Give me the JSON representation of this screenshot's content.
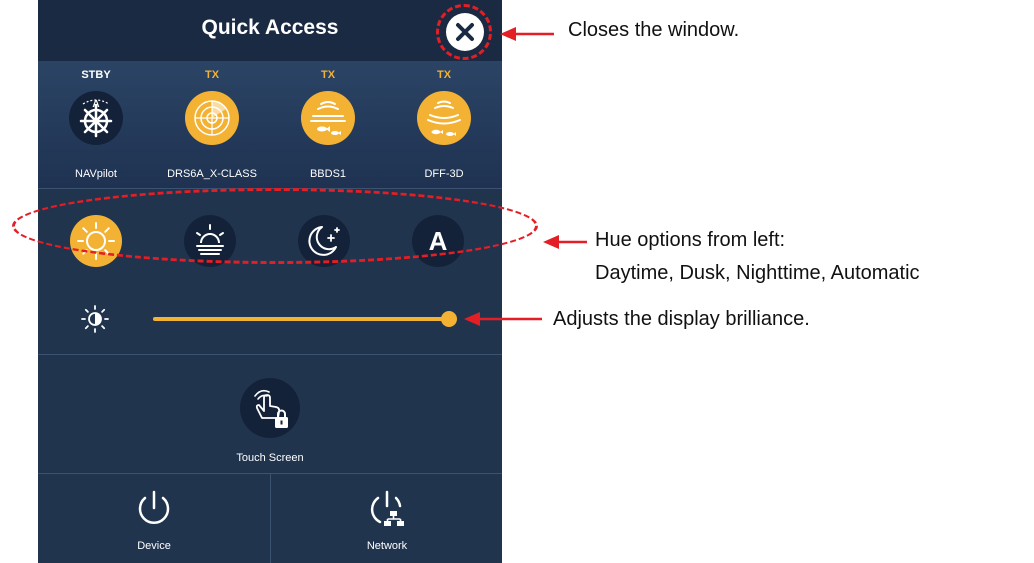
{
  "panel": {
    "title": "Quick Access",
    "close_icon": "close-icon"
  },
  "devices": [
    {
      "status": "STBY",
      "label": "NAVpilot",
      "icon": "autopilot-helm-icon",
      "status_color": "#ffffff",
      "icon_bg": "#132238"
    },
    {
      "status": "TX",
      "label": "DRS6A_X-CLASS",
      "icon": "radar-icon",
      "status_color": "#f3b234",
      "icon_bg": "#f3b234"
    },
    {
      "status": "TX",
      "label": "BBDS1",
      "icon": "sonar-fish-icon",
      "status_color": "#f3b234",
      "icon_bg": "#f3b234"
    },
    {
      "status": "TX",
      "label": "DFF-3D",
      "icon": "multibeam-fish-icon",
      "status_color": "#f3b234",
      "icon_bg": "#f3b234"
    }
  ],
  "hue_options": [
    {
      "name": "Daytime",
      "icon": "sun-icon",
      "selected": true
    },
    {
      "name": "Dusk",
      "icon": "sunset-icon",
      "selected": false
    },
    {
      "name": "Nighttime",
      "icon": "moon-stars-icon",
      "selected": false
    },
    {
      "name": "Automatic",
      "icon": "letter-a-icon",
      "glyph": "A",
      "selected": false
    }
  ],
  "brilliance": {
    "icon": "brightness-contrast-icon",
    "level_fraction": 1.0
  },
  "touch_screen": {
    "label": "Touch Screen",
    "icon": "touch-lock-icon"
  },
  "power": {
    "device_label": "Device",
    "network_label": "Network",
    "device_icon": "power-icon",
    "network_icon": "network-power-icon"
  },
  "colors": {
    "panel_bg": "#21344e",
    "header_bg": "#1a2a42",
    "accent": "#f3b234",
    "annotation_red": "#e31e24"
  },
  "annotations": {
    "close": "Closes the window.",
    "hue_line1": "Hue options from left:",
    "hue_line2": "Daytime, Dusk, Nighttime, Automatic",
    "brilliance": "Adjusts the display brilliance."
  }
}
